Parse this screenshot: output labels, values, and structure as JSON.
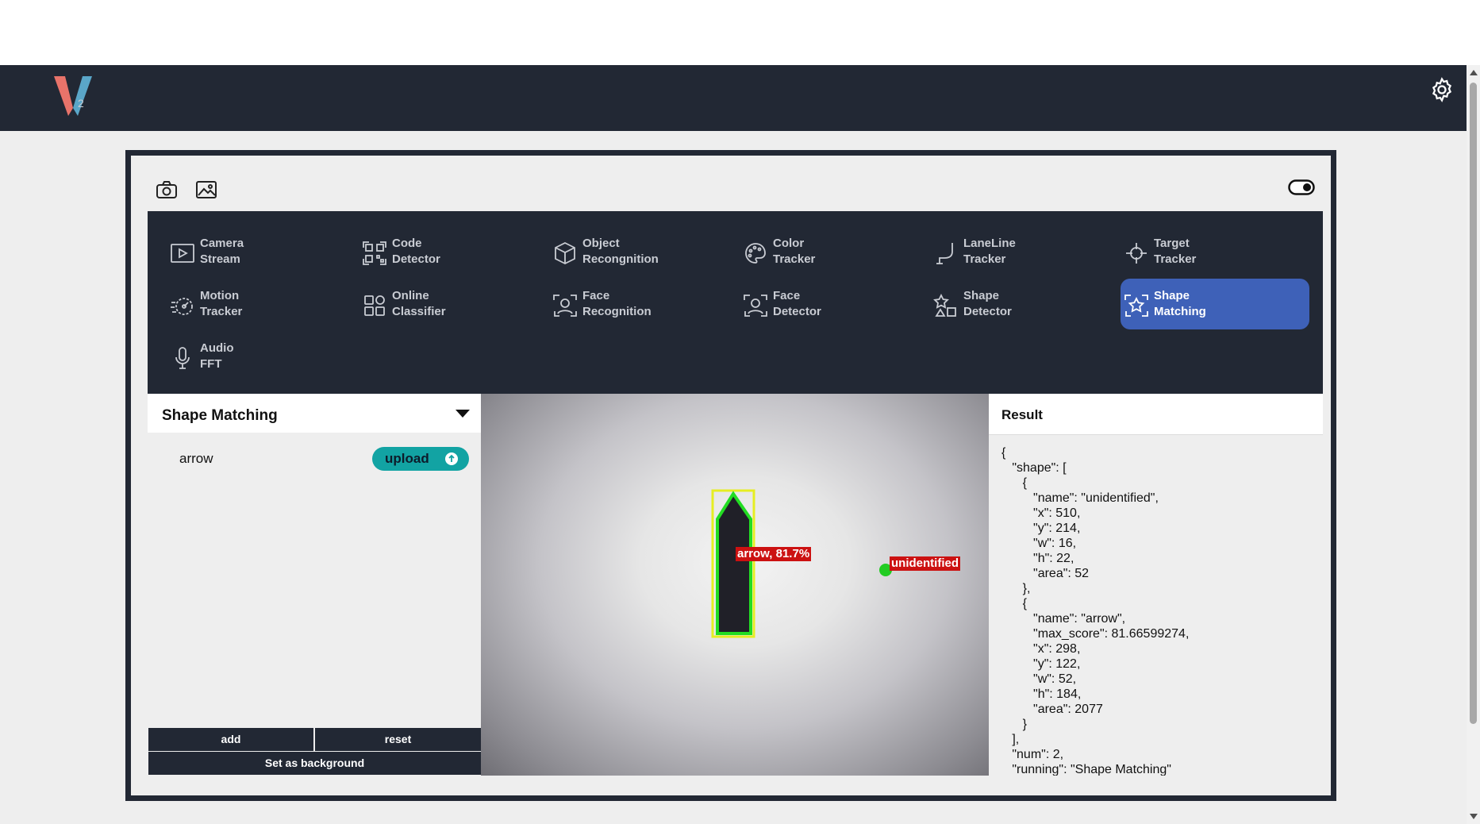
{
  "app": {
    "logo_letter": "V",
    "logo_sub": "2"
  },
  "nav": [
    {
      "line1": "Camera",
      "line2": "Stream",
      "icon": "play-icon"
    },
    {
      "line1": "Code",
      "line2": "Detector",
      "icon": "qr-icon"
    },
    {
      "line1": "Object",
      "line2": "Recongnition",
      "icon": "cube-icon"
    },
    {
      "line1": "Color",
      "line2": "Tracker",
      "icon": "palette-icon"
    },
    {
      "line1": "LaneLine",
      "line2": "Tracker",
      "icon": "lane-icon"
    },
    {
      "line1": "Target",
      "line2": "Tracker",
      "icon": "crosshair-icon"
    },
    {
      "line1": "Motion",
      "line2": "Tracker",
      "icon": "motion-icon"
    },
    {
      "line1": "Online",
      "line2": "Classifier",
      "icon": "grid-icon"
    },
    {
      "line1": "Face",
      "line2": "Recognition",
      "icon": "face-scan-icon"
    },
    {
      "line1": "Face",
      "line2": "Detector",
      "icon": "face-scan-icon"
    },
    {
      "line1": "Shape",
      "line2": "Detector",
      "icon": "shapes-icon"
    },
    {
      "line1": "Shape",
      "line2": "Matching",
      "icon": "star-scan-icon",
      "active": true
    },
    {
      "line1": "Audio",
      "line2": "FFT",
      "icon": "microphone-icon"
    }
  ],
  "left_panel": {
    "title": "Shape Matching",
    "shape_name": "arrow",
    "upload_label": "upload",
    "add_label": "add",
    "reset_label": "reset",
    "background_label": "Set as background"
  },
  "viewer": {
    "tag_arrow": "arrow, 81.7%",
    "tag_unidentified": "unidentified"
  },
  "result": {
    "title": "Result",
    "json_text": "{\n   \"shape\": [\n      {\n         \"name\": \"unidentified\",\n         \"x\": 510,\n         \"y\": 214,\n         \"w\": 16,\n         \"h\": 22,\n         \"area\": 52\n      },\n      {\n         \"name\": \"arrow\",\n         \"max_score\": 81.66599274,\n         \"x\": 298,\n         \"y\": 122,\n         \"w\": 52,\n         \"h\": 184,\n         \"area\": 2077\n      }\n   ],\n   \"num\": 2,\n   \"running\": \"Shape Matching\""
  },
  "colors": {
    "dark": "#222834",
    "active": "#3e61b8",
    "upload": "#12a3a3",
    "tag": "#cc1111"
  }
}
